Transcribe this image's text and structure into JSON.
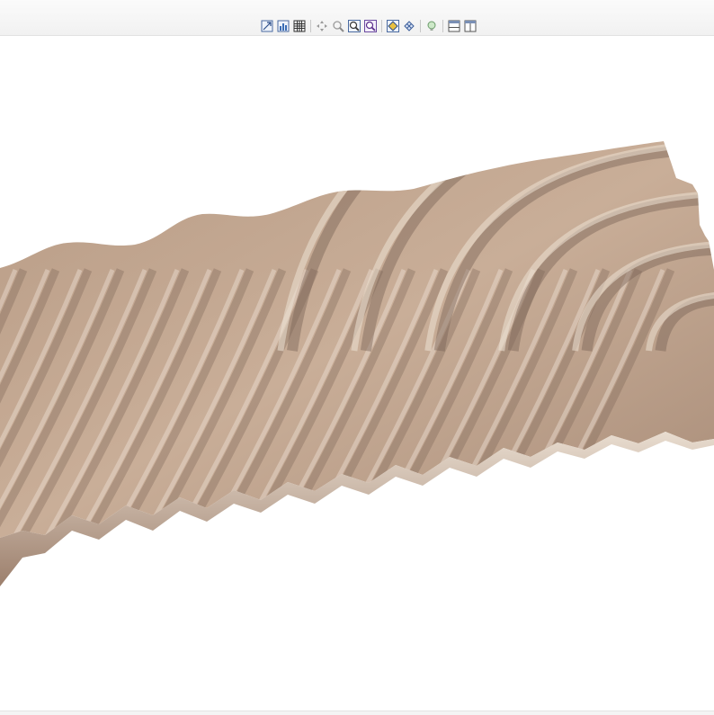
{
  "toolbar": {
    "buttons": [
      {
        "name": "view-fit-icon",
        "tooltip": ""
      },
      {
        "name": "view-chart-icon",
        "tooltip": ""
      },
      {
        "name": "grid-icon",
        "tooltip": ""
      },
      {
        "name": "rotate-icon",
        "tooltip": ""
      },
      {
        "name": "zoom-icon",
        "tooltip": ""
      },
      {
        "name": "zoom-in-icon",
        "tooltip": ""
      },
      {
        "name": "zoom-out-icon",
        "tooltip": ""
      },
      {
        "name": "shade-icon",
        "tooltip": ""
      },
      {
        "name": "mesh-icon",
        "tooltip": ""
      },
      {
        "name": "lighting-icon",
        "tooltip": ""
      },
      {
        "name": "layout-horizontal-icon",
        "tooltip": ""
      },
      {
        "name": "layout-vertical-icon",
        "tooltip": ""
      }
    ]
  },
  "surface": {
    "material_color": "#c7ab94",
    "highlight_color": "#ede1d4",
    "shadow_color": "#7a6356"
  }
}
